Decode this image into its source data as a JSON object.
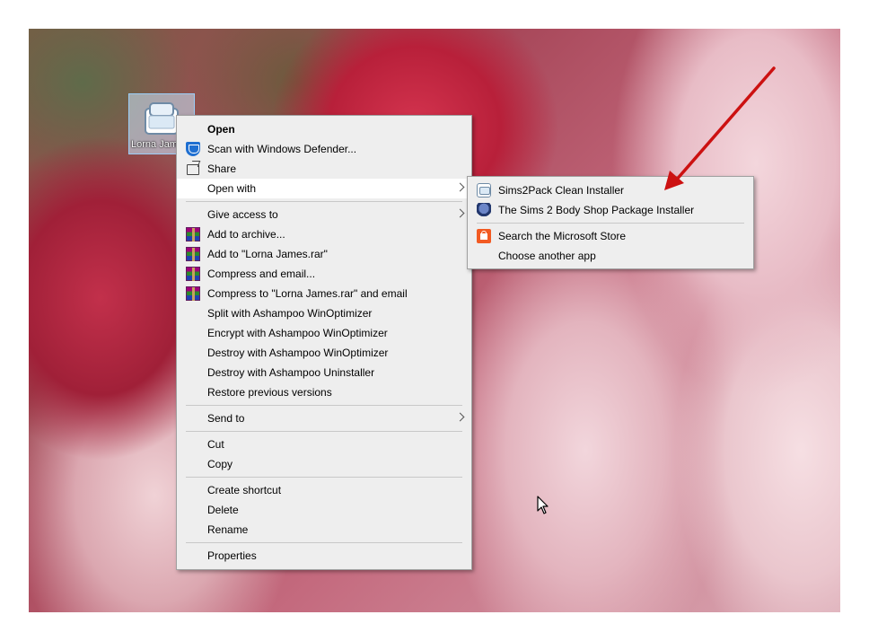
{
  "desktop_icon": {
    "label": "Lorna Jam"
  },
  "context_menu": {
    "items": [
      {
        "label": "Open"
      },
      {
        "label": "Scan with Windows Defender..."
      },
      {
        "label": "Share"
      },
      {
        "label": "Open with"
      },
      {
        "label": "Give access to"
      },
      {
        "label": "Add to archive..."
      },
      {
        "label": "Add to \"Lorna James.rar\""
      },
      {
        "label": "Compress and email..."
      },
      {
        "label": "Compress to \"Lorna James.rar\" and email"
      },
      {
        "label": "Split with Ashampoo WinOptimizer"
      },
      {
        "label": "Encrypt with Ashampoo WinOptimizer"
      },
      {
        "label": "Destroy with Ashampoo WinOptimizer"
      },
      {
        "label": "Destroy with Ashampoo Uninstaller"
      },
      {
        "label": "Restore previous versions"
      },
      {
        "label": "Send to"
      },
      {
        "label": "Cut"
      },
      {
        "label": "Copy"
      },
      {
        "label": "Create shortcut"
      },
      {
        "label": "Delete"
      },
      {
        "label": "Rename"
      },
      {
        "label": "Properties"
      }
    ]
  },
  "open_with_submenu": {
    "items": [
      {
        "label": "Sims2Pack Clean Installer"
      },
      {
        "label": "The Sims 2 Body Shop Package Installer"
      },
      {
        "label": "Search the Microsoft Store"
      },
      {
        "label": "Choose another app"
      }
    ]
  },
  "icons": {
    "defender": "shield-icon",
    "share": "share-icon",
    "winrar": "winrar-icon",
    "sims2pack": "sims2pack-icon",
    "bodyshop": "bodyshop-icon",
    "store": "store-icon",
    "submenu_arrow": "chevron-right-icon"
  },
  "colors": {
    "menu_background": "#eeeeee",
    "menu_hover": "#ffffff",
    "annotation_arrow": "#cc1111"
  }
}
